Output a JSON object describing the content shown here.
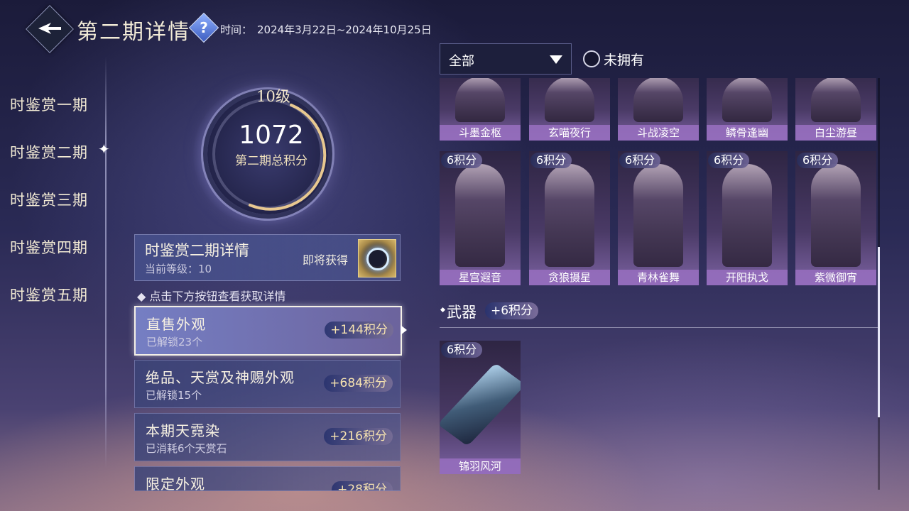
{
  "header": {
    "title": "第二期详情",
    "time_label": "时间：",
    "time_value": "2024年3月22日~2024年10月25日"
  },
  "sidebar": {
    "items": [
      {
        "label": "时鉴赏一期"
      },
      {
        "label": "时鉴赏二期",
        "selected": true
      },
      {
        "label": "时鉴赏三期"
      },
      {
        "label": "时鉴赏四期"
      },
      {
        "label": "时鉴赏五期"
      }
    ]
  },
  "score": {
    "level": "10级",
    "value": "1072",
    "label": "第二期总积分"
  },
  "detail": {
    "title": "时鉴赏二期详情",
    "current_level": "当前等级：10",
    "coming_reward": "即将获得"
  },
  "tip": "点击下方按钮查看获取详情",
  "categories": [
    {
      "title": "直售外观",
      "sub": "已解锁23个",
      "points": "+144积分",
      "active": true
    },
    {
      "title": "绝品、天赏及神赐外观",
      "sub": "已解锁15个",
      "points": "+684积分"
    },
    {
      "title": "本期天霓染",
      "sub": "已消耗6个天赏石",
      "points": "+216积分"
    },
    {
      "title": "限定外观",
      "sub": "",
      "points": "+28积分"
    }
  ],
  "filter": {
    "dropdown_value": "全部",
    "not_owned_label": "未拥有"
  },
  "outfits_top": [
    {
      "name": "斗墨金枢"
    },
    {
      "name": "玄喵夜行"
    },
    {
      "name": "斗战凌空"
    },
    {
      "name": "鳞骨逢幽"
    },
    {
      "name": "白尘游昼"
    }
  ],
  "outfits": [
    {
      "name": "星宫遐音",
      "points": "6积分"
    },
    {
      "name": "贪狼摄星",
      "points": "6积分"
    },
    {
      "name": "青林雀舞",
      "points": "6积分"
    },
    {
      "name": "开阳执戈",
      "points": "6积分"
    },
    {
      "name": "紫微御宵",
      "points": "6积分"
    }
  ],
  "weapon_section": {
    "title": "武器",
    "points": "+6积分",
    "items": [
      {
        "name": "锦羽风河",
        "points": "6积分"
      }
    ]
  },
  "colors": {
    "accent_gold": "#f2e3bd",
    "card_purple": "#9a6ec0",
    "ring_gold": "#e8c890"
  }
}
